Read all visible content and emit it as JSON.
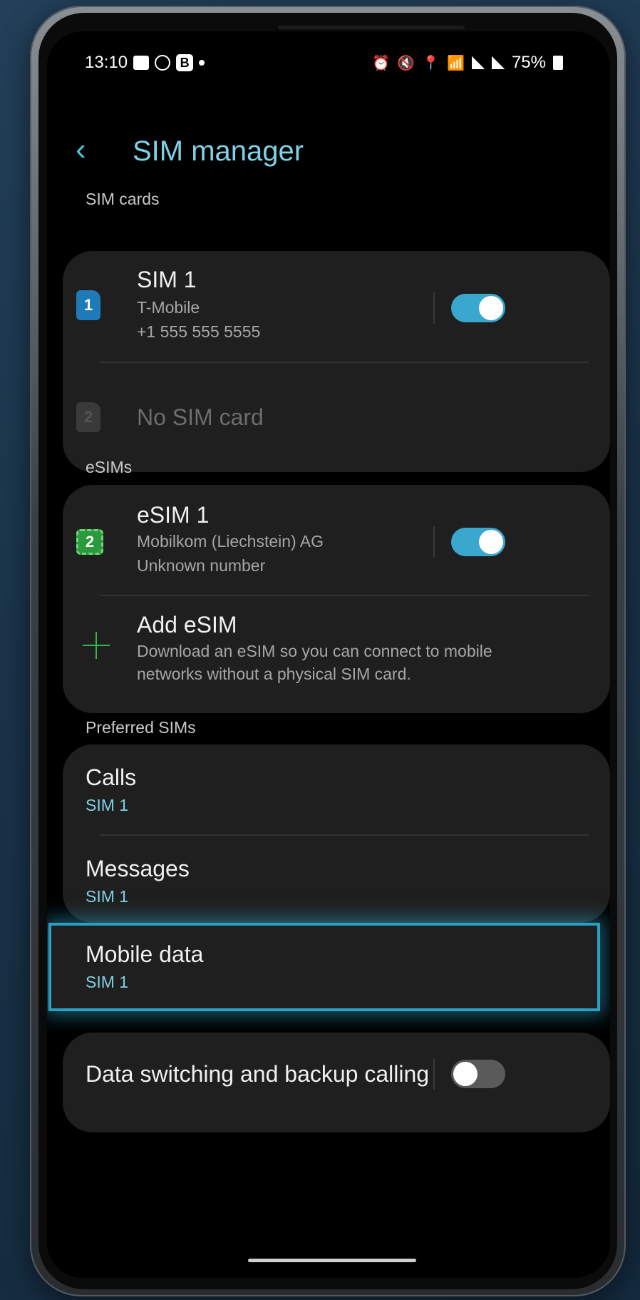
{
  "status_bar": {
    "time": "13:10",
    "battery": "75%"
  },
  "header": {
    "title": "SIM manager"
  },
  "sim_cards": {
    "section_label": "SIM cards",
    "sim1": {
      "badge": "1",
      "name": "SIM 1",
      "carrier": "T-Mobile",
      "number": "+1 555 555 5555",
      "enabled": true
    },
    "sim2": {
      "badge": "2",
      "name": "No SIM card"
    }
  },
  "esims": {
    "section_label": "eSIMs",
    "esim1": {
      "badge": "2",
      "name": "eSIM 1",
      "carrier": "Mobilkom (Liechstein) AG",
      "number": "Unknown number",
      "enabled": true
    },
    "add": {
      "title": "Add eSIM",
      "desc_line1": "Download an eSIM so you can connect to mobile",
      "desc_line2": "networks without a physical SIM card."
    }
  },
  "preferred": {
    "section_label": "Preferred SIMs",
    "calls": {
      "title": "Calls",
      "value": "SIM 1"
    },
    "messages": {
      "title": "Messages",
      "value": "SIM 1"
    },
    "mobile_data": {
      "title": "Mobile data",
      "value": "SIM 1"
    }
  },
  "data_switching": {
    "title": "Data switching and backup calling",
    "enabled": false
  },
  "colors": {
    "accent": "#7fd1e6",
    "toggle_on": "#3aa7cf",
    "highlight": "#2c9ec2"
  }
}
